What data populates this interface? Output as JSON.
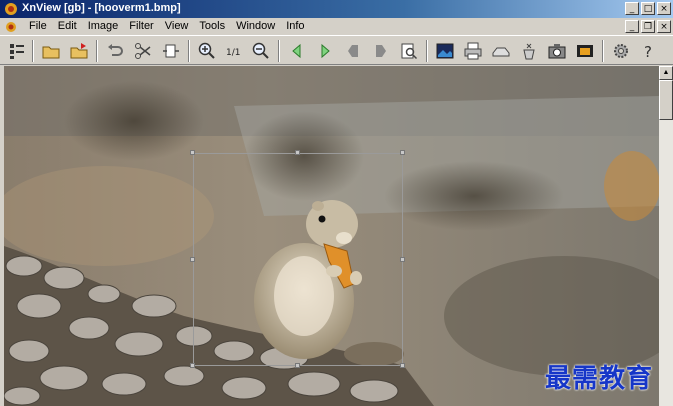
{
  "window": {
    "title": "XnView [gb] - [hooverm1.bmp]",
    "controls": {
      "minimize": "_",
      "maximize": "□",
      "close": "×"
    },
    "mdi_controls": {
      "minimize": "_",
      "restore": "❐",
      "close": "×"
    }
  },
  "menu": {
    "items": [
      "File",
      "Edit",
      "Image",
      "Filter",
      "View",
      "Tools",
      "Window",
      "Info"
    ]
  },
  "toolbar": {
    "icons": [
      "browser-icon",
      "open-folder-icon",
      "save-icon",
      "undo-icon",
      "crop-icon",
      "resize-icon",
      "zoom-in-icon",
      "zoom-1to1-icon",
      "zoom-out-icon",
      "previous-icon",
      "next-icon",
      "first-icon",
      "last-icon",
      "fullscreen-icon",
      "slideshow-icon",
      "print-icon",
      "scanner-icon",
      "acquire-icon",
      "capture-icon",
      "camera-icon",
      "options-icon",
      "help-icon"
    ],
    "zoom_1to1_label": "1/1"
  },
  "watermark": {
    "text": "最需教育"
  },
  "colors": {
    "title_start": "#0a246a",
    "title_end": "#a6caf0",
    "face": "#d4d0c8",
    "watermark": "#1636c8"
  }
}
